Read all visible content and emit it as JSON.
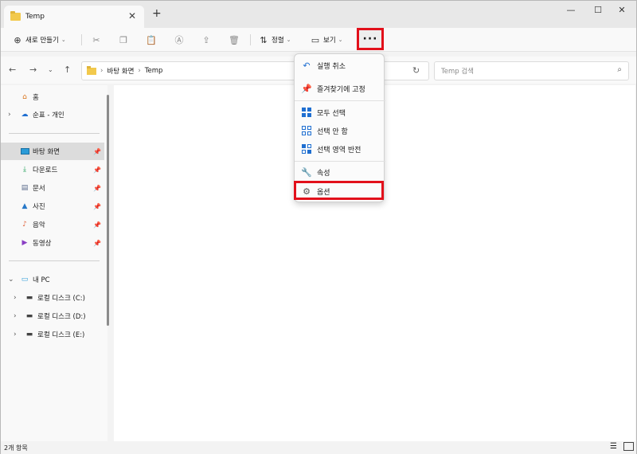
{
  "window": {
    "tab_title": "Temp",
    "new_tab": "+",
    "close_tab": "✕",
    "controls": {
      "minimize": "—",
      "maximize": "☐",
      "close": "✕"
    }
  },
  "toolbar": {
    "new_label": "새로 만들기",
    "sort_label": "정렬",
    "view_label": "보기",
    "more_label": "···"
  },
  "address": {
    "crumbs": [
      "바탕 화면",
      "Temp"
    ],
    "search_placeholder": "Temp 검색"
  },
  "sidebar": {
    "home": "홈",
    "onedrive": "순표 - 개인",
    "quick": [
      {
        "label": "바탕 화면",
        "icon": "desktop-icon"
      },
      {
        "label": "다운로드",
        "icon": "download-icon"
      },
      {
        "label": "문서",
        "icon": "document-icon"
      },
      {
        "label": "사진",
        "icon": "picture-icon"
      },
      {
        "label": "음악",
        "icon": "music-icon"
      },
      {
        "label": "동영상",
        "icon": "video-icon"
      }
    ],
    "this_pc": "내 PC",
    "drives": [
      "로컬 디스크 (C:)",
      "로컬 디스크 (D:)",
      "로컬 디스크 (E:)"
    ]
  },
  "menu": {
    "items": [
      "실행 취소",
      "즐겨찾기에 고정",
      "모두 선택",
      "선택 안 함",
      "선택 영역 반전",
      "속성",
      "옵션"
    ]
  },
  "status": {
    "count": "2개 항목"
  },
  "colors": {
    "highlight": "#e2101b",
    "accent": "#1f6fd1",
    "folder": "#f2c94c"
  }
}
